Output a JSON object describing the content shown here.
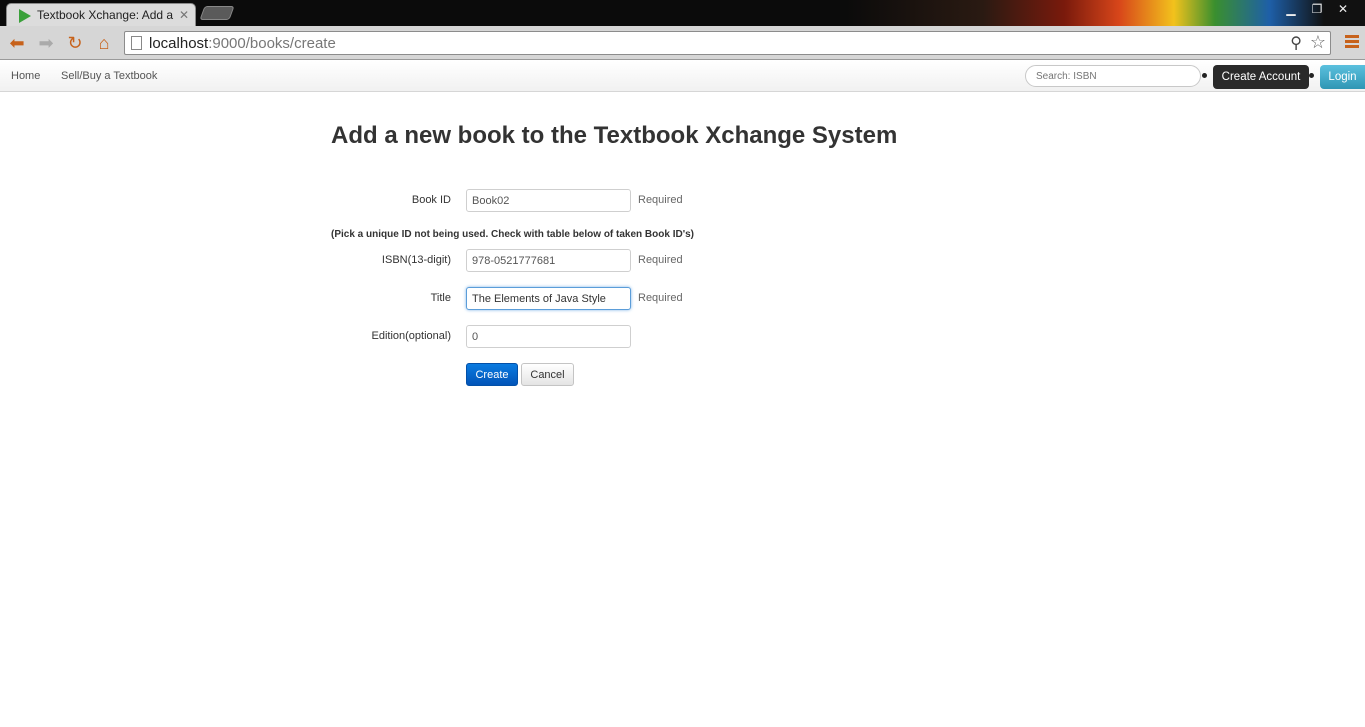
{
  "browser": {
    "tab_title": "Textbook Xchange: Add a",
    "url_host": "localhost",
    "url_path": ":9000/books/create",
    "accent_color": "#c7621b"
  },
  "navbar": {
    "links": [
      "Home",
      "Sell/Buy a Textbook"
    ],
    "search_placeholder": "Search: ISBN",
    "create_account_label": "Create Account",
    "login_label": "Login"
  },
  "page": {
    "title": "Add a new book to the Textbook Xchange System"
  },
  "form": {
    "book_id": {
      "label": "Book ID",
      "value": "Book02",
      "help": "Required"
    },
    "hint": "(Pick a unique ID not being used. Check with table below of taken Book ID's)",
    "isbn": {
      "label": "ISBN(13-digit)",
      "value": "978-0521777681",
      "help": "Required"
    },
    "title": {
      "label": "Title",
      "value": "The Elements of Java Style",
      "help": "Required"
    },
    "edition": {
      "label": "Edition(optional)",
      "value": "0"
    },
    "create_label": "Create",
    "cancel_label": "Cancel"
  }
}
